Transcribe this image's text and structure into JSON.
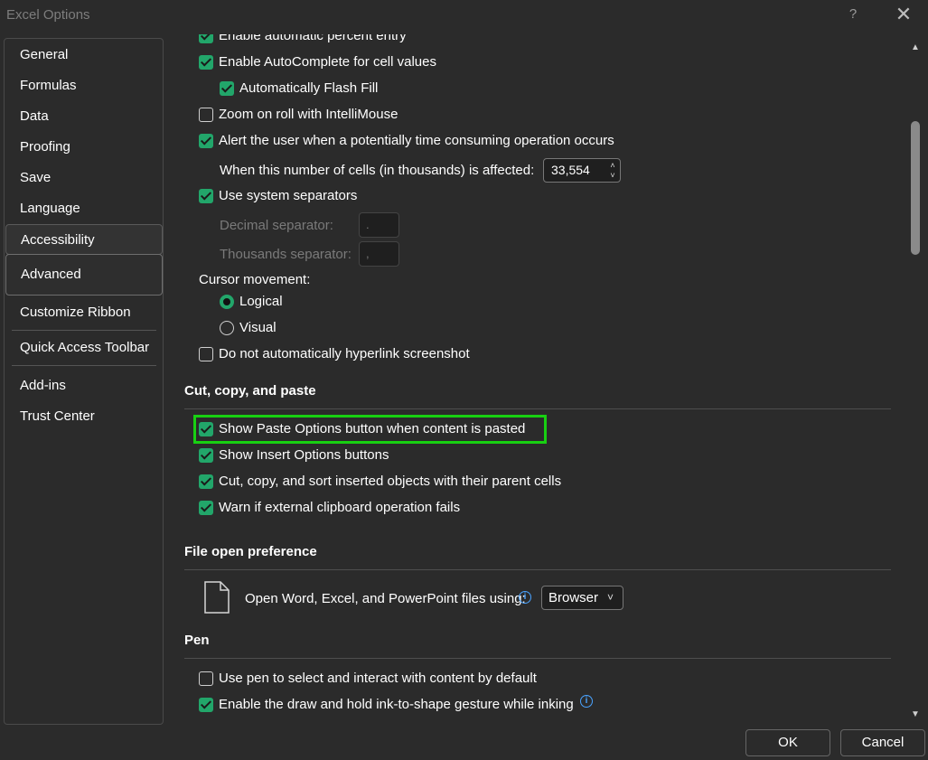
{
  "window": {
    "title": "Excel Options",
    "help": "?",
    "close": "✕"
  },
  "nav": {
    "items": [
      {
        "label": "General"
      },
      {
        "label": "Formulas"
      },
      {
        "label": "Data"
      },
      {
        "label": "Proofing"
      },
      {
        "label": "Save"
      },
      {
        "label": "Language"
      },
      {
        "label": "Accessibility"
      },
      {
        "label": "Advanced"
      },
      {
        "label": "Customize Ribbon"
      },
      {
        "label": "Quick Access Toolbar"
      },
      {
        "label": "Add-ins"
      },
      {
        "label": "Trust Center"
      }
    ],
    "selected": "Advanced"
  },
  "editing": {
    "partial_item": "Enable automatic percent entry",
    "autocomplete": "Enable AutoComplete for cell values",
    "flash_fill": "Automatically Flash Fill",
    "zoom_intellimouse": "Zoom on roll with IntelliMouse",
    "alert_time_consuming": "Alert the user when a potentially time consuming operation occurs",
    "cells_affected_label": "When this number of cells (in thousands) is affected:",
    "cells_affected_value": "33,554",
    "system_separators": "Use system separators",
    "decimal_separator_label": "Decimal separator:",
    "decimal_separator_value": ".",
    "thousands_separator_label": "Thousands separator:",
    "thousands_separator_value": ",",
    "cursor_movement_label": "Cursor movement:",
    "cursor_logical": "Logical",
    "cursor_visual": "Visual",
    "no_hyperlink_screenshot": "Do not automatically hyperlink screenshot"
  },
  "cut_copy_paste": {
    "heading": "Cut, copy, and paste",
    "show_paste_options": "Show Paste Options button when content is pasted",
    "show_insert_options": "Show Insert Options buttons",
    "cut_copy_sort": "Cut, copy, and sort inserted objects with their parent cells",
    "warn_clipboard": "Warn if external clipboard operation fails"
  },
  "file_open": {
    "heading": "File open preference",
    "label": "Open Word, Excel, and PowerPoint files using:",
    "value": "Browser"
  },
  "pen": {
    "heading": "Pen",
    "use_pen": "Use pen to select and interact with content by default",
    "ink_to_shape": "Enable the draw and hold ink-to-shape gesture while inking"
  },
  "footer": {
    "ok": "OK",
    "cancel": "Cancel"
  },
  "colors": {
    "accent": "#22a66a",
    "highlight": "#18d012",
    "background": "#2b2b2b"
  }
}
